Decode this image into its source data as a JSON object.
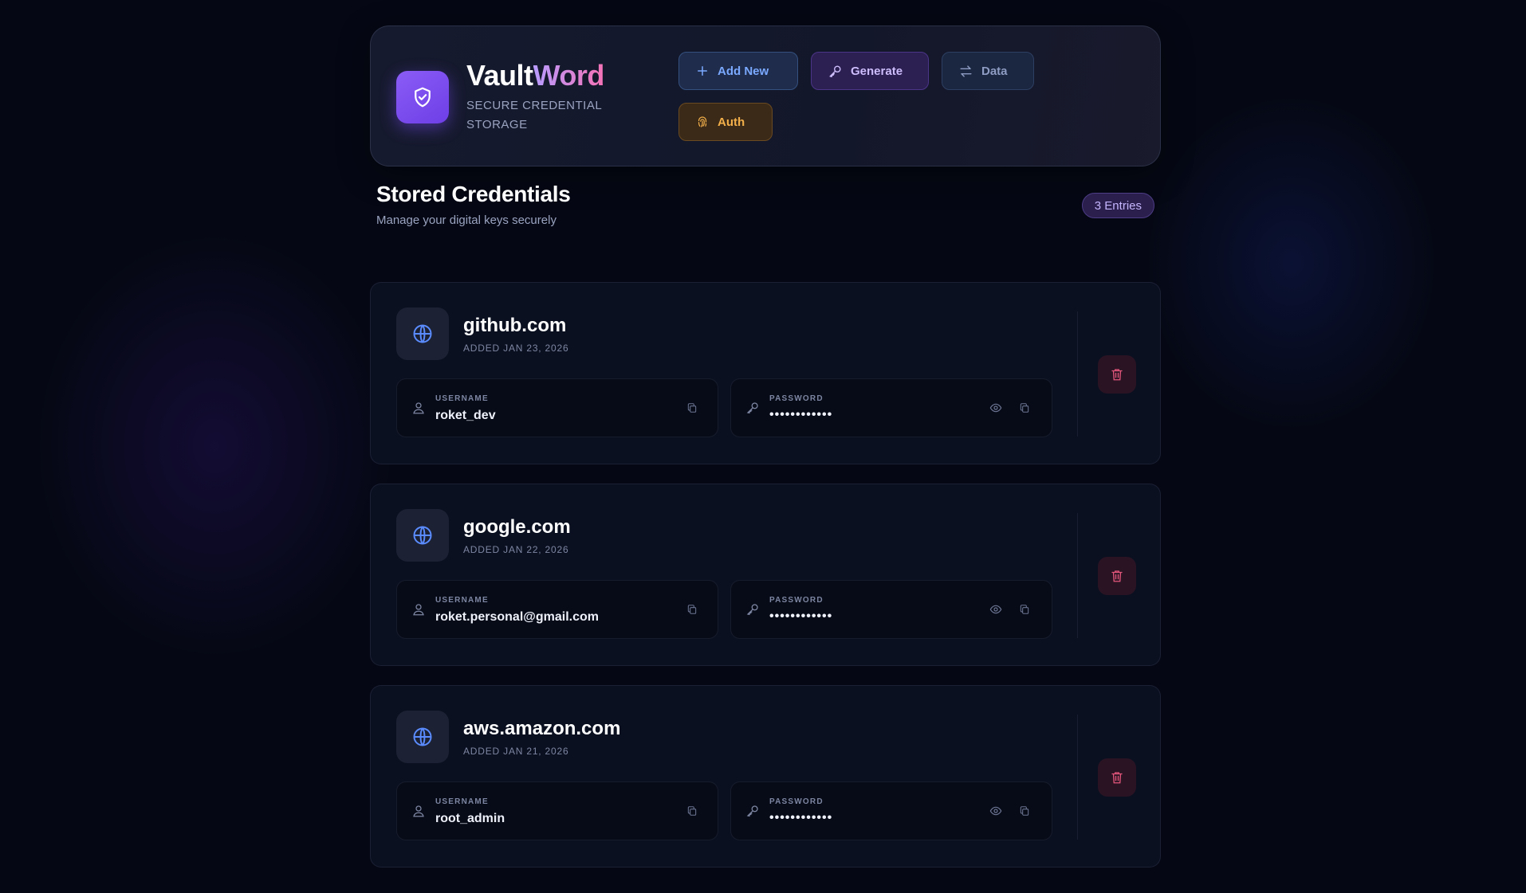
{
  "brand": {
    "title_part1": "Vault",
    "title_part2": "Word",
    "subtitle": "SECURE CREDENTIAL STORAGE"
  },
  "toolbar": {
    "add_label": "Add New",
    "generate_label": "Generate",
    "data_label": "Data",
    "auth_label": "Auth"
  },
  "section": {
    "title": "Stored Credentials",
    "subtitle": "Manage your digital keys securely",
    "count_badge": "3 Entries"
  },
  "labels": {
    "username": "USERNAME",
    "password": "PASSWORD"
  },
  "credentials": [
    {
      "site": "github.com",
      "added": "ADDED JAN 23, 2026",
      "username": "roket_dev",
      "password_masked": "••••••••••••"
    },
    {
      "site": "google.com",
      "added": "ADDED JAN 22, 2026",
      "username": "roket.personal@gmail.com",
      "password_masked": "••••••••••••"
    },
    {
      "site": "aws.amazon.com",
      "added": "ADDED JAN 21, 2026",
      "username": "root_admin",
      "password_masked": "••••••••••••"
    }
  ],
  "colors": {
    "background": "#050814",
    "accent_purple": "#8b5cf6",
    "accent_blue": "#7aa9ff",
    "accent_amber": "#f3b04a",
    "danger_pink": "#f472b6"
  },
  "icons": {
    "logo": "shield-check-icon",
    "add": "plus-icon",
    "generate": "key-icon",
    "data": "swap-arrows-icon",
    "auth": "fingerprint-icon",
    "site": "globe-icon",
    "username": "user-icon",
    "password": "key-icon",
    "reveal": "eye-icon",
    "copy": "copy-icon",
    "delete": "trash-icon"
  }
}
